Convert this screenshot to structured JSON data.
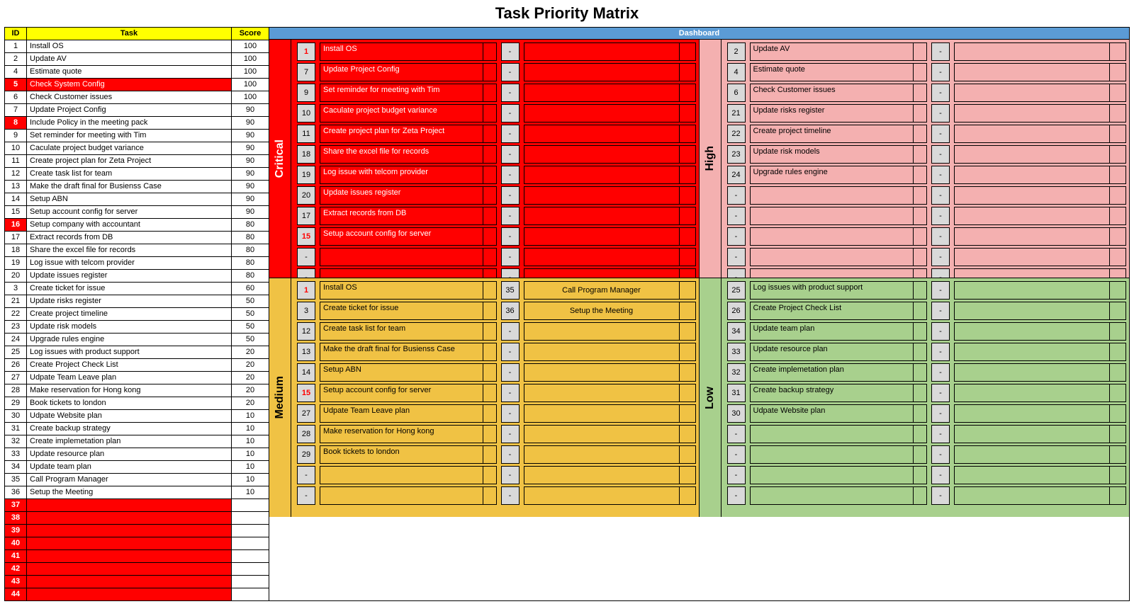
{
  "title": "Task Priority Matrix",
  "left": {
    "headers": {
      "id": "ID",
      "task": "Task",
      "score": "Score"
    },
    "rows": [
      {
        "id": "1",
        "task": "Install OS",
        "score": "100"
      },
      {
        "id": "2",
        "task": "Update AV",
        "score": "100"
      },
      {
        "id": "4",
        "task": "Estimate quote",
        "score": "100"
      },
      {
        "id": "5",
        "task": "Check System Config",
        "score": "100",
        "idred": true,
        "taskred": true
      },
      {
        "id": "6",
        "task": "Check Customer issues",
        "score": "100"
      },
      {
        "id": "7",
        "task": "Update Project Config",
        "score": "90"
      },
      {
        "id": "8",
        "task": "Include Policy in the meeting pack",
        "score": "90",
        "idred": true
      },
      {
        "id": "9",
        "task": "Set reminder for meeting with Tim",
        "score": "90"
      },
      {
        "id": "10",
        "task": "Caculate project budget variance",
        "score": "90"
      },
      {
        "id": "11",
        "task": "Create project plan for Zeta Project",
        "score": "90"
      },
      {
        "id": "12",
        "task": "Create task list for team",
        "score": "90"
      },
      {
        "id": "13",
        "task": "Make the draft final for Busienss Case",
        "score": "90"
      },
      {
        "id": "14",
        "task": "Setup ABN",
        "score": "90"
      },
      {
        "id": "15",
        "task": "Setup account config for server",
        "score": "90"
      },
      {
        "id": "16",
        "task": "Setup company with accountant",
        "score": "80",
        "idred": true
      },
      {
        "id": "17",
        "task": "Extract records from DB",
        "score": "80"
      },
      {
        "id": "18",
        "task": "Share the excel file for records",
        "score": "80"
      },
      {
        "id": "19",
        "task": "Log issue with telcom provider",
        "score": "80"
      },
      {
        "id": "20",
        "task": "Update issues register",
        "score": "80"
      },
      {
        "id": "3",
        "task": "Create ticket for issue",
        "score": "60"
      },
      {
        "id": "21",
        "task": "Update risks register",
        "score": "50"
      },
      {
        "id": "22",
        "task": "Create project timeline",
        "score": "50"
      },
      {
        "id": "23",
        "task": "Update risk models",
        "score": "50"
      },
      {
        "id": "24",
        "task": "Upgrade rules engine",
        "score": "50"
      },
      {
        "id": "25",
        "task": "Log issues with product support",
        "score": "20"
      },
      {
        "id": "26",
        "task": "Create Project Check List",
        "score": "20"
      },
      {
        "id": "27",
        "task": "Udpate Team Leave plan",
        "score": "20"
      },
      {
        "id": "28",
        "task": "Make reservation for Hong kong",
        "score": "20"
      },
      {
        "id": "29",
        "task": "Book tickets to london",
        "score": "20"
      },
      {
        "id": "30",
        "task": "Udpate Website plan",
        "score": "10"
      },
      {
        "id": "31",
        "task": "Create backup strategy",
        "score": "10"
      },
      {
        "id": "32",
        "task": "Create implemetation plan",
        "score": "10"
      },
      {
        "id": "33",
        "task": "Update resource plan",
        "score": "10"
      },
      {
        "id": "34",
        "task": "Update team plan",
        "score": "10"
      },
      {
        "id": "35",
        "task": "Call Program Manager",
        "score": "10"
      },
      {
        "id": "36",
        "task": "Setup the Meeting",
        "score": "10"
      },
      {
        "id": "37",
        "task": "",
        "score": "",
        "idred": true,
        "taskred": true
      },
      {
        "id": "38",
        "task": "",
        "score": "",
        "idred": true,
        "taskred": true
      },
      {
        "id": "39",
        "task": "",
        "score": "",
        "idred": true,
        "taskred": true
      },
      {
        "id": "40",
        "task": "",
        "score": "",
        "idred": true,
        "taskred": true
      },
      {
        "id": "41",
        "task": "",
        "score": "",
        "idred": true,
        "taskred": true
      },
      {
        "id": "42",
        "task": "",
        "score": "",
        "idred": true,
        "taskred": true
      },
      {
        "id": "43",
        "task": "",
        "score": "",
        "idred": true,
        "taskred": true
      },
      {
        "id": "44",
        "task": "",
        "score": "",
        "idred": true,
        "taskred": true
      }
    ]
  },
  "dashboard": {
    "header": "Dashboard",
    "critical": {
      "label": "Critical",
      "rows": [
        {
          "n": "1",
          "t": "Install OS",
          "red": true
        },
        {
          "n": "7",
          "t": "Update Project Config"
        },
        {
          "n": "9",
          "t": "Set reminder for meeting with Tim"
        },
        {
          "n": "10",
          "t": "Caculate project budget variance"
        },
        {
          "n": "11",
          "t": "Create project plan for Zeta Project"
        },
        {
          "n": "18",
          "t": "Share the excel file for records"
        },
        {
          "n": "19",
          "t": "Log issue with telcom provider"
        },
        {
          "n": "20",
          "t": "Update issues register"
        },
        {
          "n": "17",
          "t": "Extract records from DB"
        },
        {
          "n": "15",
          "t": "Setup account config for server",
          "red": true
        },
        {
          "n": "-",
          "t": ""
        },
        {
          "n": "-",
          "t": ""
        }
      ]
    },
    "high": {
      "label": "High",
      "rows": [
        {
          "n": "2",
          "t": "Update AV"
        },
        {
          "n": "4",
          "t": "Estimate quote"
        },
        {
          "n": "6",
          "t": "Check Customer issues"
        },
        {
          "n": "21",
          "t": "Update risks register"
        },
        {
          "n": "22",
          "t": "Create project timeline"
        },
        {
          "n": "23",
          "t": "Update risk models"
        },
        {
          "n": "24",
          "t": "Upgrade rules engine"
        },
        {
          "n": "-",
          "t": ""
        },
        {
          "n": "-",
          "t": ""
        },
        {
          "n": "-",
          "t": ""
        },
        {
          "n": "-",
          "t": ""
        },
        {
          "n": "-",
          "t": ""
        }
      ]
    },
    "medium": {
      "label": "Medium",
      "rows": [
        {
          "n": "1",
          "t": "Install OS",
          "red": true,
          "n2": "35",
          "t2": "Call Program Manager"
        },
        {
          "n": "3",
          "t": "Create ticket for issue",
          "n2": "36",
          "t2": "Setup the Meeting"
        },
        {
          "n": "12",
          "t": "Create task list for team"
        },
        {
          "n": "13",
          "t": "Make the draft final for Busienss Case"
        },
        {
          "n": "14",
          "t": "Setup ABN"
        },
        {
          "n": "15",
          "t": "Setup account config for server",
          "red": true
        },
        {
          "n": "27",
          "t": "Udpate Team Leave plan"
        },
        {
          "n": "28",
          "t": "Make reservation for Hong kong"
        },
        {
          "n": "29",
          "t": "Book tickets to london"
        },
        {
          "n": "-",
          "t": ""
        },
        {
          "n": "-",
          "t": ""
        }
      ]
    },
    "low": {
      "label": "Low",
      "rows": [
        {
          "n": "25",
          "t": "Log issues with product support"
        },
        {
          "n": "26",
          "t": "Create Project Check List"
        },
        {
          "n": "34",
          "t": "Update team plan"
        },
        {
          "n": "33",
          "t": "Update resource plan"
        },
        {
          "n": "32",
          "t": "Create implemetation plan"
        },
        {
          "n": "31",
          "t": "Create backup strategy"
        },
        {
          "n": "30",
          "t": "Udpate Website plan"
        },
        {
          "n": "-",
          "t": ""
        },
        {
          "n": "-",
          "t": ""
        },
        {
          "n": "-",
          "t": ""
        },
        {
          "n": "-",
          "t": ""
        }
      ]
    }
  }
}
